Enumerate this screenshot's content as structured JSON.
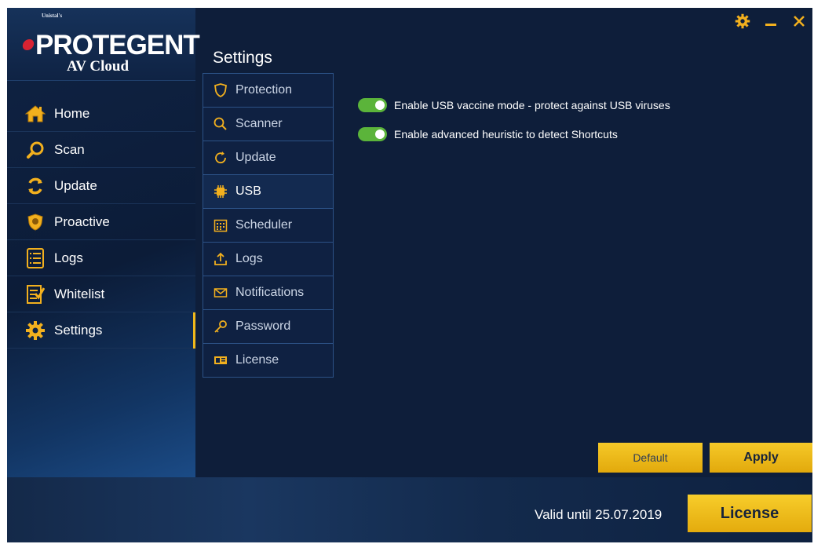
{
  "brand": {
    "company": "Unistal's",
    "name": "PROTEGENT",
    "product": "AV Cloud"
  },
  "nav": {
    "items": [
      {
        "label": "Home",
        "icon": "home-icon"
      },
      {
        "label": "Scan",
        "icon": "magnifier-icon"
      },
      {
        "label": "Update",
        "icon": "refresh-icon"
      },
      {
        "label": "Proactive",
        "icon": "shield-icon"
      },
      {
        "label": "Logs",
        "icon": "list-icon"
      },
      {
        "label": "Whitelist",
        "icon": "checklist-icon"
      },
      {
        "label": "Settings",
        "icon": "gear-icon",
        "active": true
      }
    ]
  },
  "page": {
    "title": "Settings"
  },
  "submenu": {
    "items": [
      {
        "label": "Protection",
        "icon": "shield-outline-icon"
      },
      {
        "label": "Scanner",
        "icon": "search-icon"
      },
      {
        "label": "Update",
        "icon": "refresh-icon"
      },
      {
        "label": "USB",
        "icon": "chip-icon",
        "active": true
      },
      {
        "label": "Scheduler",
        "icon": "calendar-icon"
      },
      {
        "label": "Logs",
        "icon": "upload-icon"
      },
      {
        "label": "Notifications",
        "icon": "envelope-icon"
      },
      {
        "label": "Password",
        "icon": "key-icon"
      },
      {
        "label": "License",
        "icon": "license-card-icon"
      }
    ]
  },
  "usb_options": [
    {
      "label": "Enable USB vaccine mode - protect against USB viruses",
      "enabled": true
    },
    {
      "label": "Enable advanced heuristic to detect Shortcuts",
      "enabled": true
    }
  ],
  "actions": {
    "default_label": "Default",
    "apply_label": "Apply"
  },
  "footer": {
    "valid_text": "Valid until 25.07.2019",
    "license_label": "License"
  },
  "colors": {
    "accent": "#f0b81b",
    "toggle_on": "#5bb43a",
    "background": "#0e1e3a"
  }
}
